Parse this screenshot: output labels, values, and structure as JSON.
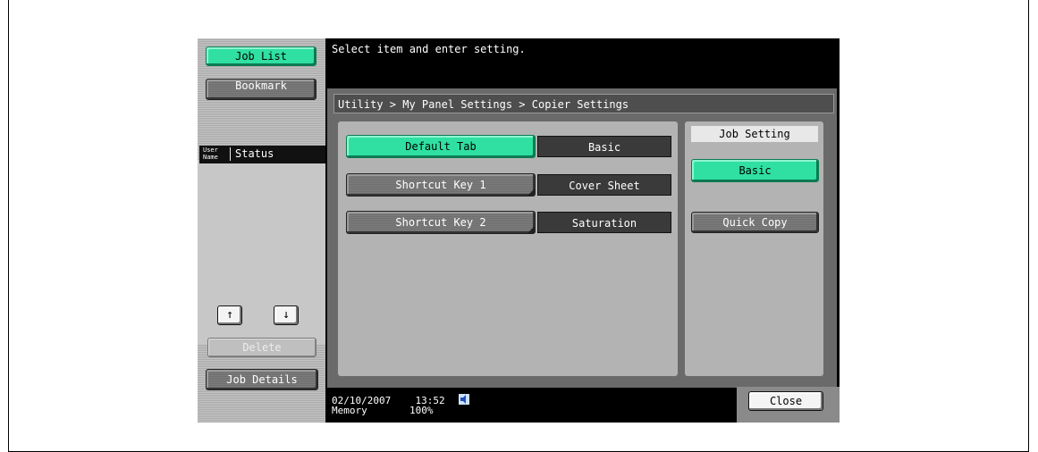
{
  "message": "Select item and enter setting.",
  "breadcrumb": "Utility > My Panel Settings > Copier Settings",
  "sidebar": {
    "job_list": "Job List",
    "bookmark": "Bookmark",
    "user_name": "User Name",
    "user_label_line1": "User",
    "user_label_line2": "Name",
    "status": "Status",
    "up_arrow": "↑",
    "down_arrow": "↓",
    "delete": "Delete",
    "job_details": "Job Details"
  },
  "settings": [
    {
      "label": "Default Tab",
      "value": "Basic",
      "selected": true
    },
    {
      "label": "Shortcut Key 1",
      "value": "Cover Sheet",
      "selected": false
    },
    {
      "label": "Shortcut Key 2",
      "value": "Saturation",
      "selected": false
    }
  ],
  "job_setting": {
    "title": "Job Setting",
    "options": [
      "Basic",
      "Quick Copy"
    ],
    "selected": "Basic"
  },
  "footer": {
    "date": "02/10/2007",
    "time": "13:52",
    "memory_label": "Memory",
    "memory_value": "100%",
    "close": "Close"
  },
  "colors": {
    "accent_green": "#2fe0a2",
    "screen_bg": "#000000",
    "panel_gray": "#b3b3b3"
  }
}
